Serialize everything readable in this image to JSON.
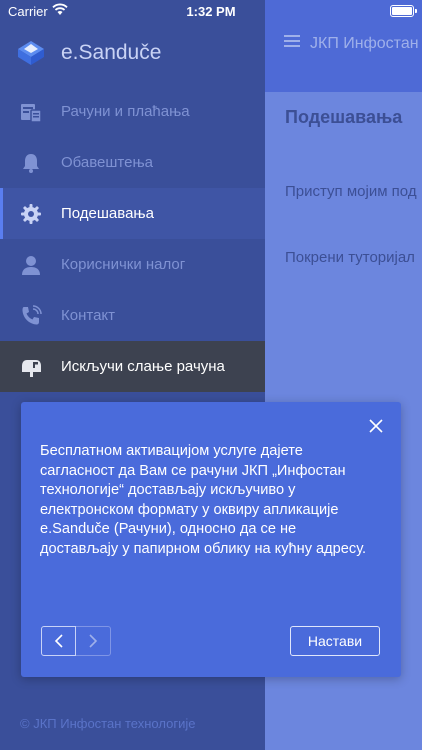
{
  "status_bar": {
    "carrier": "Carrier",
    "time": "1:32 PM"
  },
  "main": {
    "header_title": "ЈКП Инфостан т",
    "heading": "Подешавања",
    "rows": [
      "Приступ мојим под",
      "Покрени туторијал"
    ]
  },
  "drawer": {
    "brand": "e.Sanduče",
    "items": [
      {
        "label": "Рачуни и плаћања",
        "icon": "bills-icon",
        "state": "normal"
      },
      {
        "label": "Обавештења",
        "icon": "bell-icon",
        "state": "normal"
      },
      {
        "label": "Подешавања",
        "icon": "gear-icon",
        "state": "active"
      },
      {
        "label": "Кориснички налог",
        "icon": "user-icon",
        "state": "normal"
      },
      {
        "label": "Контакт",
        "icon": "phone-icon",
        "state": "normal"
      },
      {
        "label": "Искључи слање рачуна",
        "icon": "mailbox-icon",
        "state": "dark"
      }
    ],
    "footer": "© ЈКП Инфостан технологије"
  },
  "dialog": {
    "text": "Бесплатном активацијом услуге дајете сагласност да Вам се рачуни ЈКП „Инфостан технологије“ достављају искључиво у електронском формату у оквиру апликације e.Sanduče (Рачуни), односно да се не достављају у папирном облику на кућну адресу.",
    "continue_label": "Настави"
  },
  "colors": {
    "drawer_bg": "#3a4f9a",
    "main_bg": "#6c86de",
    "dialog_bg": "#4a6bdb",
    "accent": "#5a7ef0"
  }
}
